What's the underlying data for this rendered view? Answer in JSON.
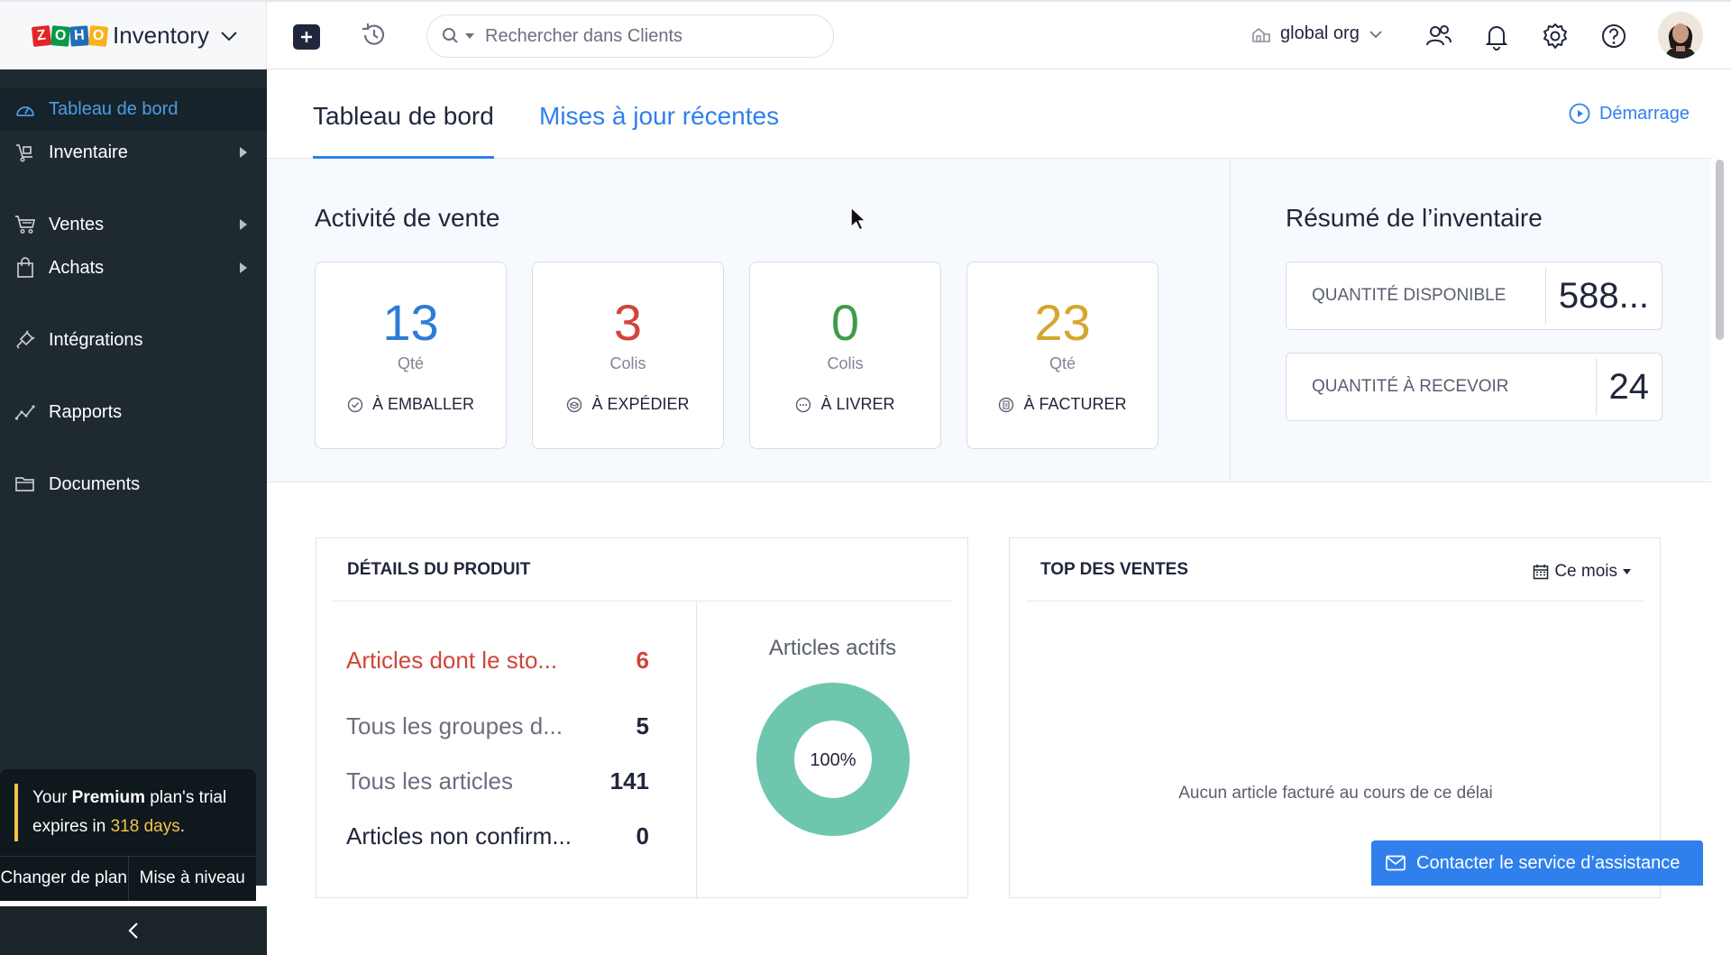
{
  "brand": {
    "logo_letters": [
      "Z",
      "O",
      "H",
      "O"
    ],
    "name": "Inventory"
  },
  "topbar": {
    "search_placeholder": "Rechercher dans Clients",
    "org_name": "global org"
  },
  "sidebar": {
    "items": [
      {
        "label": "Tableau de bord",
        "icon": "dashboard-icon",
        "active": true
      },
      {
        "label": "Inventaire",
        "icon": "inventory-icon",
        "has_submenu": true
      },
      {
        "label": "Ventes",
        "icon": "cart-icon",
        "has_submenu": true
      },
      {
        "label": "Achats",
        "icon": "bag-icon",
        "has_submenu": true
      },
      {
        "label": "Intégrations",
        "icon": "plug-icon"
      },
      {
        "label": "Rapports",
        "icon": "reports-icon"
      },
      {
        "label": "Documents",
        "icon": "folder-icon"
      }
    ],
    "trial": {
      "prefix": "Your ",
      "plan": "Premium",
      "middle": " plan's trial expires in ",
      "days": "318 days",
      "suffix": ".",
      "change_plan": "Changer de plan",
      "upgrade": "Mise à niveau"
    }
  },
  "tabs": {
    "dashboard": "Tableau de bord",
    "updates": "Mises à jour récentes",
    "getting_started": "Démarrage"
  },
  "sales_activity": {
    "title": "Activité de vente",
    "cards": [
      {
        "value": "13",
        "unit": "Qté",
        "action": "À EMBALLER",
        "color": "#2f7bd9"
      },
      {
        "value": "3",
        "unit": "Colis",
        "action": "À EXPÉDIER",
        "color": "#d0453a"
      },
      {
        "value": "0",
        "unit": "Colis",
        "action": "À LIVRER",
        "color": "#3d9c4c"
      },
      {
        "value": "23",
        "unit": "Qté",
        "action": "À FACTURER",
        "color": "#d4a72c"
      }
    ]
  },
  "inventory_summary": {
    "title": "Résumé de l’inventaire",
    "rows": [
      {
        "label": "QUANTITÉ DISPONIBLE",
        "value": "588..."
      },
      {
        "label": "QUANTITÉ À RECEVOIR",
        "value": "24"
      }
    ]
  },
  "product_details": {
    "title": "DÉTAILS DU PRODUIT",
    "rows": [
      {
        "label": "Articles dont le sto...",
        "value": "6",
        "highlight": true
      },
      {
        "label": "Tous les groupes d...",
        "value": "5"
      },
      {
        "label": "Tous les articles",
        "value": "141"
      },
      {
        "label": "Articles non confirm...",
        "value": "0",
        "dark": true
      }
    ],
    "active_items_title": "Articles actifs",
    "active_items_percent": "100%",
    "active_items_fraction": 1.0,
    "donut_color": "#6ec6ae"
  },
  "top_sales": {
    "title": "TOP DES VENTES",
    "period": "Ce mois",
    "empty_message": "Aucun article facturé au cours de ce délai"
  },
  "support": {
    "label": "Contacter le service d’assistance"
  }
}
